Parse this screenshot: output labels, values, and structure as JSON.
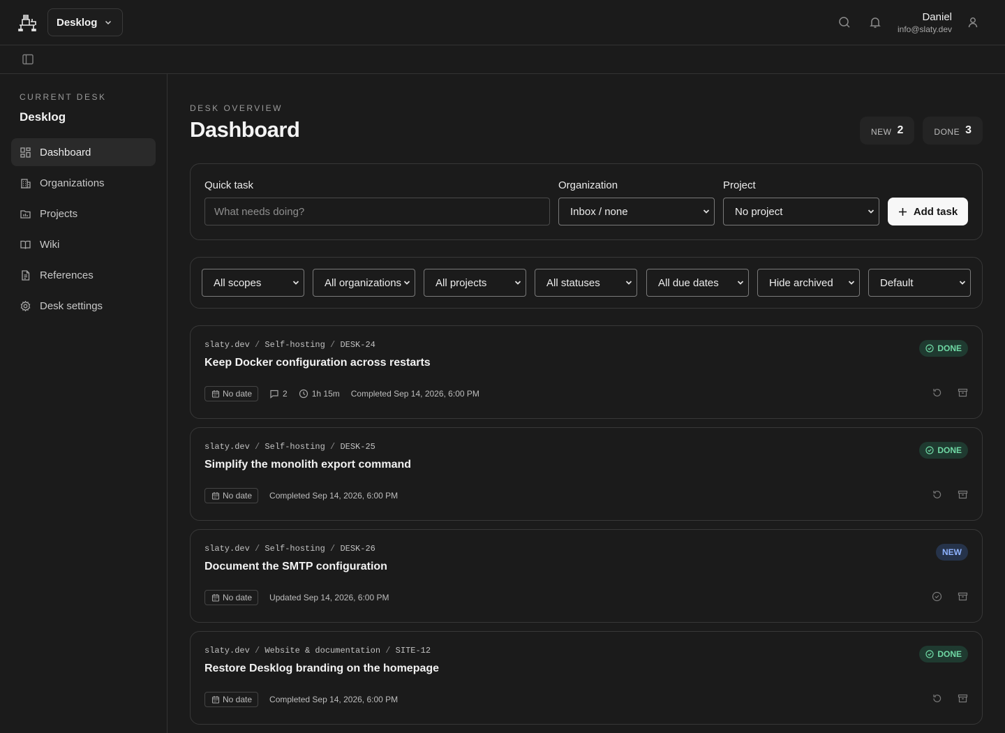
{
  "header": {
    "desk_switcher": "Desklog",
    "user_name": "Daniel",
    "user_email": "info@slaty.dev"
  },
  "sidebar": {
    "section_label": "CURRENT DESK",
    "desk_name": "Desklog",
    "items": [
      {
        "label": "Dashboard",
        "icon": "dashboard-icon",
        "active": true
      },
      {
        "label": "Organizations",
        "icon": "building-icon"
      },
      {
        "label": "Projects",
        "icon": "folder-icon"
      },
      {
        "label": "Wiki",
        "icon": "book-icon"
      },
      {
        "label": "References",
        "icon": "document-icon"
      },
      {
        "label": "Desk settings",
        "icon": "gear-icon"
      }
    ]
  },
  "main": {
    "eyebrow": "DESK OVERVIEW",
    "title": "Dashboard",
    "stats": [
      {
        "label": "NEW",
        "value": "2"
      },
      {
        "label": "DONE",
        "value": "3"
      }
    ]
  },
  "quick_task": {
    "task_label": "Quick task",
    "task_placeholder": "What needs doing?",
    "org_label": "Organization",
    "org_value": "Inbox / none",
    "project_label": "Project",
    "project_value": "No project",
    "add_button": "Add task"
  },
  "filters": {
    "scope": "All scopes",
    "organization": "All organizations",
    "project": "All projects",
    "status": "All statuses",
    "due": "All due dates",
    "archived": "Hide archived",
    "sort": "Default"
  },
  "tasks": [
    {
      "org": "slaty.dev",
      "project": "Self-hosting",
      "key": "DESK-24",
      "title": "Keep Docker configuration across restarts",
      "date": "No date",
      "comments": "2",
      "time": "1h 15m",
      "activity": "Completed Sep 14, 2026, 6:00 PM",
      "status": "DONE"
    },
    {
      "org": "slaty.dev",
      "project": "Self-hosting",
      "key": "DESK-25",
      "title": "Simplify the monolith export command",
      "date": "No date",
      "activity": "Completed Sep 14, 2026, 6:00 PM",
      "status": "DONE"
    },
    {
      "org": "slaty.dev",
      "project": "Self-hosting",
      "key": "DESK-26",
      "title": "Document the SMTP configuration",
      "date": "No date",
      "activity": "Updated Sep 14, 2026, 6:00 PM",
      "status": "NEW"
    },
    {
      "org": "slaty.dev",
      "project": "Website & documentation",
      "key": "SITE-12",
      "title": "Restore Desklog branding on the homepage",
      "date": "No date",
      "activity": "Completed Sep 14, 2026, 6:00 PM",
      "status": "DONE"
    }
  ],
  "colors": {
    "background": "#1b1b1b",
    "done_badge": "#6fd8a4",
    "new_badge": "#8fb3ff"
  }
}
